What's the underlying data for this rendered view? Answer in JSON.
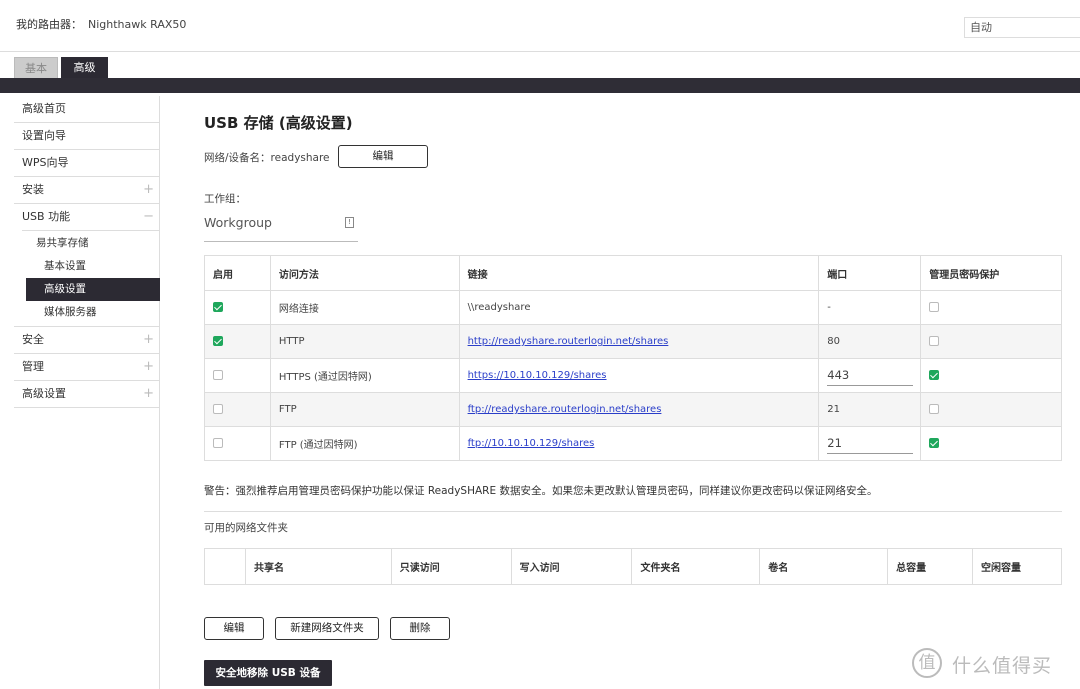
{
  "header": {
    "router_label": "我的路由器：",
    "router_model": "Nighthawk RAX50",
    "language": "自动"
  },
  "tabs": [
    {
      "label": "基本"
    },
    {
      "label": "高级"
    }
  ],
  "sidebar": {
    "items": [
      {
        "label": "高级首页"
      },
      {
        "label": "设置向导"
      },
      {
        "label": "WPS向导"
      },
      {
        "label": "安装",
        "expander": "+"
      },
      {
        "label": "USB 功能",
        "expander": "−"
      },
      {
        "label": "安全",
        "expander": "+"
      },
      {
        "label": "管理",
        "expander": "+"
      },
      {
        "label": "高级设置",
        "expander": "+"
      }
    ],
    "usb_sub": {
      "group": "易共享存储",
      "items": [
        "基本设置",
        "高级设置",
        "媒体服务器"
      ]
    }
  },
  "main": {
    "title": "USB 存储 (高级设置)",
    "device_name_label": "网络/设备名：",
    "device_name_value": "readyshare",
    "edit_label": "编辑",
    "workgroup_label": "工作组：",
    "workgroup_value": "Workgroup",
    "info_icon_glyph": "!",
    "access_table": {
      "headers": [
        "启用",
        "访问方法",
        "链接",
        "端口",
        "管理员密码保护"
      ],
      "rows": [
        {
          "method": "网络连接",
          "link": "\\\\readyshare",
          "port": "-"
        },
        {
          "method": "HTTP",
          "link": "http://readyshare.routerlogin.net/shares",
          "port": "80"
        },
        {
          "method": "HTTPS (通过因特网)",
          "link": "https://10.10.10.129/shares",
          "port": "443"
        },
        {
          "method": "FTP",
          "link": "ftp://readyshare.routerlogin.net/shares",
          "port": "21"
        },
        {
          "method": "FTP (通过因特网)",
          "link": "ftp://10.10.10.129/shares",
          "port": "21"
        }
      ],
      "enabled": [
        true,
        true,
        false,
        false,
        false
      ],
      "password_protect": [
        false,
        false,
        true,
        false,
        true
      ]
    },
    "warning": "警告：强烈推荐启用管理员密码保护功能以保证 ReadySHARE 数据安全。如果您未更改默认管理员密码，同样建议你更改密码以保证网络安全。",
    "folders_title": "可用的网络文件夹",
    "folders_headers": [
      "",
      "共享名",
      "只读访问",
      "写入访问",
      "文件夹名",
      "卷名",
      "总容量",
      "空闲容量"
    ],
    "buttons": {
      "edit": "编辑",
      "new_folder": "新建网络文件夹",
      "delete": "删除",
      "eject": "安全地移除 USB 设备"
    }
  },
  "watermark": {
    "glyph": "值",
    "text": "什么值得买"
  },
  "colors": {
    "dark": "#2c2a33",
    "check_green": "#1fa75c",
    "link_blue": "#2a3ec9"
  }
}
